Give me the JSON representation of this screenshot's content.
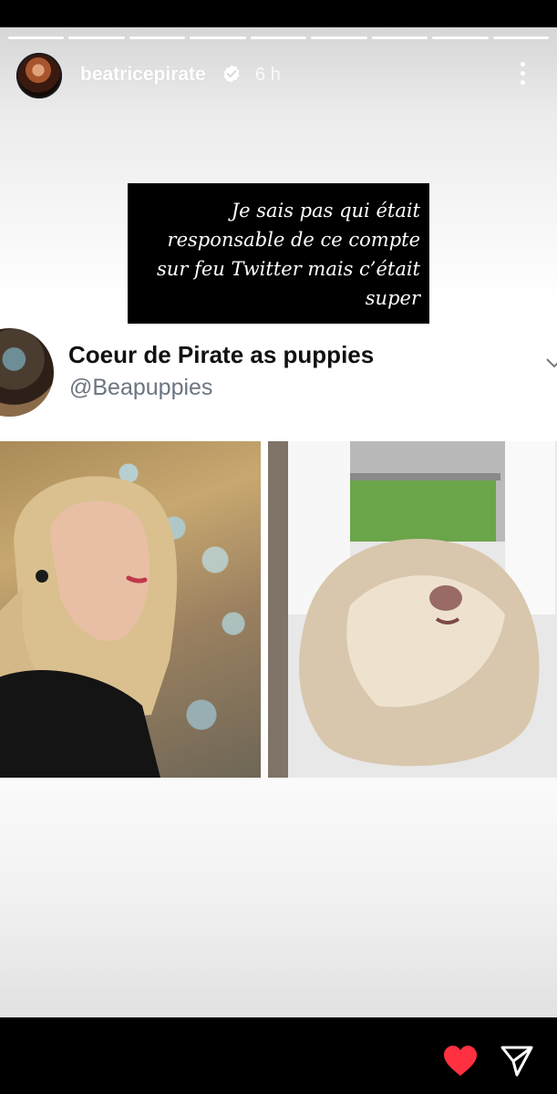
{
  "story": {
    "username": "beatricepirate",
    "time": "6 h",
    "progress_segments": 9,
    "caption_lines": [
      "Je sais pas qui était",
      "responsable de ce compte",
      "sur feu Twitter mais c’était",
      "super"
    ]
  },
  "tweet": {
    "name": "Coeur de Pirate as puppies",
    "handle": "@Beapuppies"
  },
  "icons": {
    "verified": "verified-badge-icon",
    "more": "more-vertical-icon",
    "like": "heart-icon",
    "share": "send-icon"
  },
  "colors": {
    "like": "#ff3040",
    "handle": "#6b7480"
  }
}
